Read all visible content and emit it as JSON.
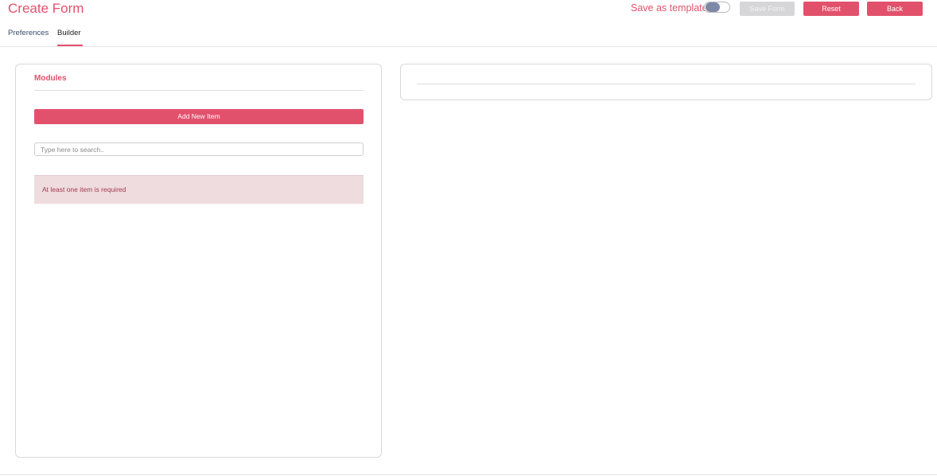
{
  "header": {
    "title": "Create Form",
    "save_as_template_label": "Save as template",
    "save_as_template_on": false,
    "buttons": {
      "save_form": "Save Form",
      "reset": "Reset",
      "back": "Back"
    }
  },
  "tabs": [
    {
      "label": "Preferences",
      "active": false
    },
    {
      "label": "Builder",
      "active": true
    }
  ],
  "modules": {
    "title": "Modules",
    "add_button": "Add New Item",
    "search": {
      "placeholder": "Type here to search..",
      "value": ""
    },
    "error_message": "At least one item is required"
  },
  "colors": {
    "accent": "#e2516c",
    "disabled_button": "#d6d6d9",
    "alert_background": "#eedcdf",
    "alert_text": "#a33a4e"
  }
}
